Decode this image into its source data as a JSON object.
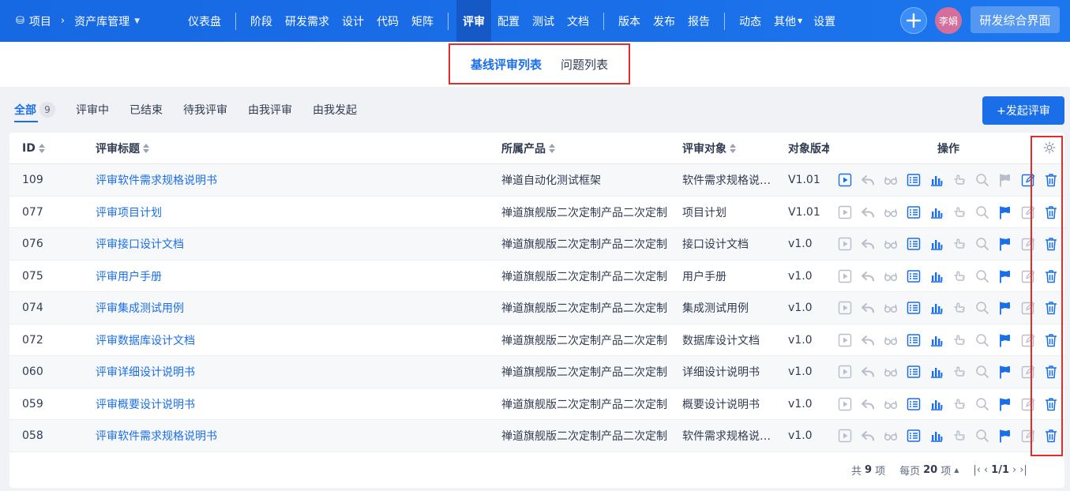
{
  "topbar": {
    "home_label": "项目",
    "project_name": "资产库管理",
    "nav": [
      "仪表盘",
      "阶段",
      "研发需求",
      "设计",
      "代码",
      "矩阵",
      "评审",
      "配置",
      "测试",
      "文档",
      "版本",
      "发布",
      "报告",
      "动态",
      "其他",
      "设置"
    ],
    "active_nav": "评审",
    "user_name": "李娟",
    "switch_label": "研发综合界面"
  },
  "subtabs": {
    "items": [
      "基线评审列表",
      "问题列表"
    ],
    "active": "基线评审列表"
  },
  "filters": {
    "items": [
      "全部",
      "评审中",
      "已结束",
      "待我评审",
      "由我评审",
      "由我发起"
    ],
    "all_count": "9",
    "active": "全部"
  },
  "create_button": "+发起评审",
  "table": {
    "headers": {
      "id": "ID",
      "title": "评审标题",
      "product": "所属产品",
      "object": "评审对象",
      "version": "对象版本",
      "actions": "操作"
    },
    "rows": [
      {
        "id": "109",
        "title": "评审软件需求规格说明书",
        "product": "禅道自动化测试框架",
        "object": "软件需求规格说明书",
        "version": "V1.01",
        "submit_active": true,
        "flag_active": false,
        "edit_active": true
      },
      {
        "id": "077",
        "title": "评审项目计划",
        "product": "禅道旗舰版二次定制产品二次定制",
        "object": "项目计划",
        "version": "V1.01",
        "submit_active": false,
        "flag_active": true,
        "edit_active": false
      },
      {
        "id": "076",
        "title": "评审接口设计文档",
        "product": "禅道旗舰版二次定制产品二次定制",
        "object": "接口设计文档",
        "version": "v1.0",
        "submit_active": false,
        "flag_active": true,
        "edit_active": false
      },
      {
        "id": "075",
        "title": "评审用户手册",
        "product": "禅道旗舰版二次定制产品二次定制",
        "object": "用户手册",
        "version": "v1.0",
        "submit_active": false,
        "flag_active": true,
        "edit_active": false
      },
      {
        "id": "074",
        "title": "评审集成测试用例",
        "product": "禅道旗舰版二次定制产品二次定制",
        "object": "集成测试用例",
        "version": "v1.0",
        "submit_active": false,
        "flag_active": true,
        "edit_active": false
      },
      {
        "id": "072",
        "title": "评审数据库设计文档",
        "product": "禅道旗舰版二次定制产品二次定制",
        "object": "数据库设计文档",
        "version": "v1.0",
        "submit_active": false,
        "flag_active": true,
        "edit_active": false
      },
      {
        "id": "060",
        "title": "评审详细设计说明书",
        "product": "禅道旗舰版二次定制产品二次定制",
        "object": "详细设计说明书",
        "version": "v1.0",
        "submit_active": false,
        "flag_active": true,
        "edit_active": false
      },
      {
        "id": "059",
        "title": "评审概要设计说明书",
        "product": "禅道旗舰版二次定制产品二次定制",
        "object": "概要设计说明书",
        "version": "v1.0",
        "submit_active": false,
        "flag_active": true,
        "edit_active": false
      },
      {
        "id": "058",
        "title": "评审软件需求规格说明书",
        "product": "禅道旗舰版二次定制产品二次定制",
        "object": "软件需求规格说明书",
        "version": "v1.0",
        "submit_active": false,
        "flag_active": true,
        "edit_active": false
      }
    ]
  },
  "pager": {
    "total_prefix": "共",
    "total": "9",
    "total_suffix": "项",
    "per_page_prefix": "每页",
    "per_page": "20",
    "per_page_suffix": "项",
    "page": "1/1"
  },
  "colors": {
    "primary": "#1a6fe8",
    "inactive_icon": "#b8bec9",
    "highlight_border": "#e12c2c"
  }
}
